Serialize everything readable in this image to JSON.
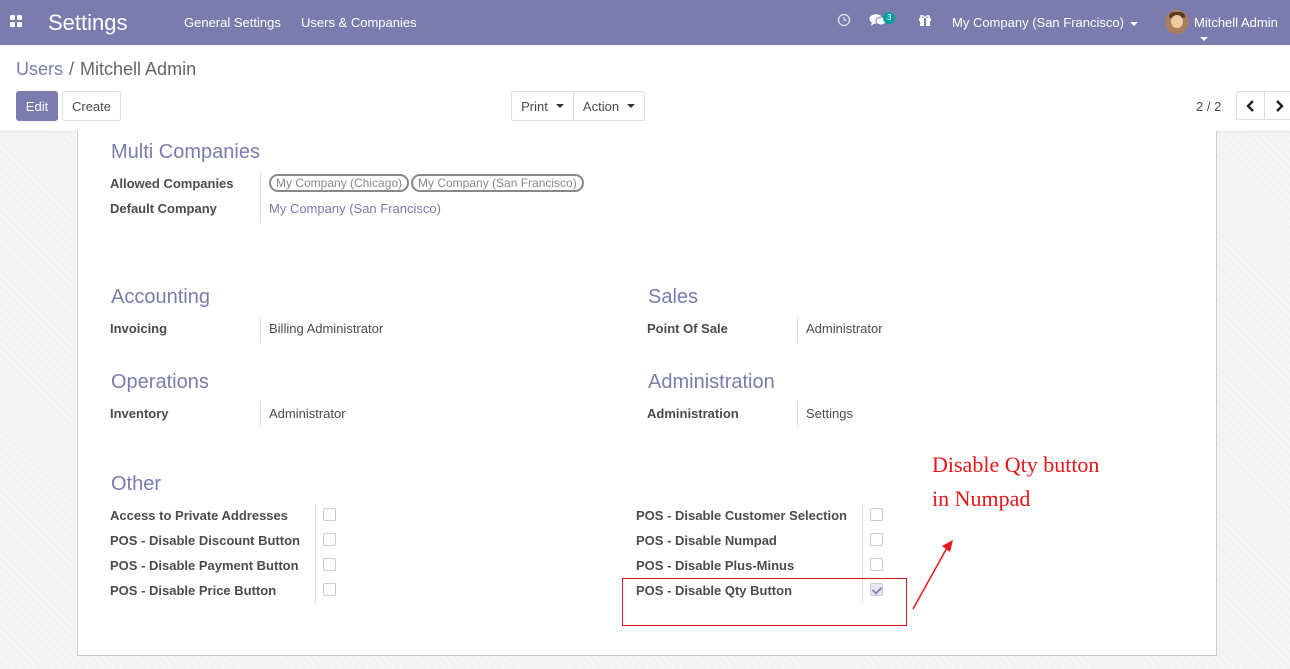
{
  "navbar": {
    "app_title": "Settings",
    "menu": [
      "General Settings",
      "Users & Companies"
    ],
    "messages_count": "3",
    "company_switcher": "My Company (San Francisco)",
    "user_name": "Mitchell Admin",
    "accent_color": "#7c7bad"
  },
  "control_panel": {
    "breadcrumb_parent": "Users",
    "breadcrumb_separator": "/",
    "breadcrumb_current": "Mitchell Admin",
    "edit_label": "Edit",
    "create_label": "Create",
    "print_label": "Print",
    "action_label": "Action",
    "pager_value": "2 / 2"
  },
  "form": {
    "multi_companies": {
      "title": "Multi Companies",
      "allowed_companies_label": "Allowed Companies",
      "allowed_companies": [
        "My Company (Chicago)",
        "My Company (San Francisco)"
      ],
      "default_company_label": "Default Company",
      "default_company": "My Company (San Francisco)"
    },
    "accounting": {
      "title": "Accounting",
      "label": "Invoicing",
      "value": "Billing Administrator"
    },
    "sales": {
      "title": "Sales",
      "label": "Point Of Sale",
      "value": "Administrator"
    },
    "operations": {
      "title": "Operations",
      "label": "Inventory",
      "value": "Administrator"
    },
    "administration": {
      "title": "Administration",
      "label": "Administration",
      "value": "Settings"
    },
    "other": {
      "title": "Other",
      "left": [
        {
          "label": "Access to Private Addresses",
          "checked": false
        },
        {
          "label": "POS - Disable Discount Button",
          "checked": false
        },
        {
          "label": "POS - Disable Payment Button",
          "checked": false
        },
        {
          "label": "POS - Disable Price Button",
          "checked": false
        }
      ],
      "right": [
        {
          "label": "POS - Disable Customer Selection",
          "checked": false
        },
        {
          "label": "POS - Disable Numpad",
          "checked": false
        },
        {
          "label": "POS - Disable Plus-Minus",
          "checked": false
        },
        {
          "label": "POS - Disable Qty Button",
          "checked": true
        }
      ]
    }
  },
  "annotation": {
    "line1": "Disable Qty button",
    "line2": "in Numpad",
    "color": "#e8161a"
  }
}
